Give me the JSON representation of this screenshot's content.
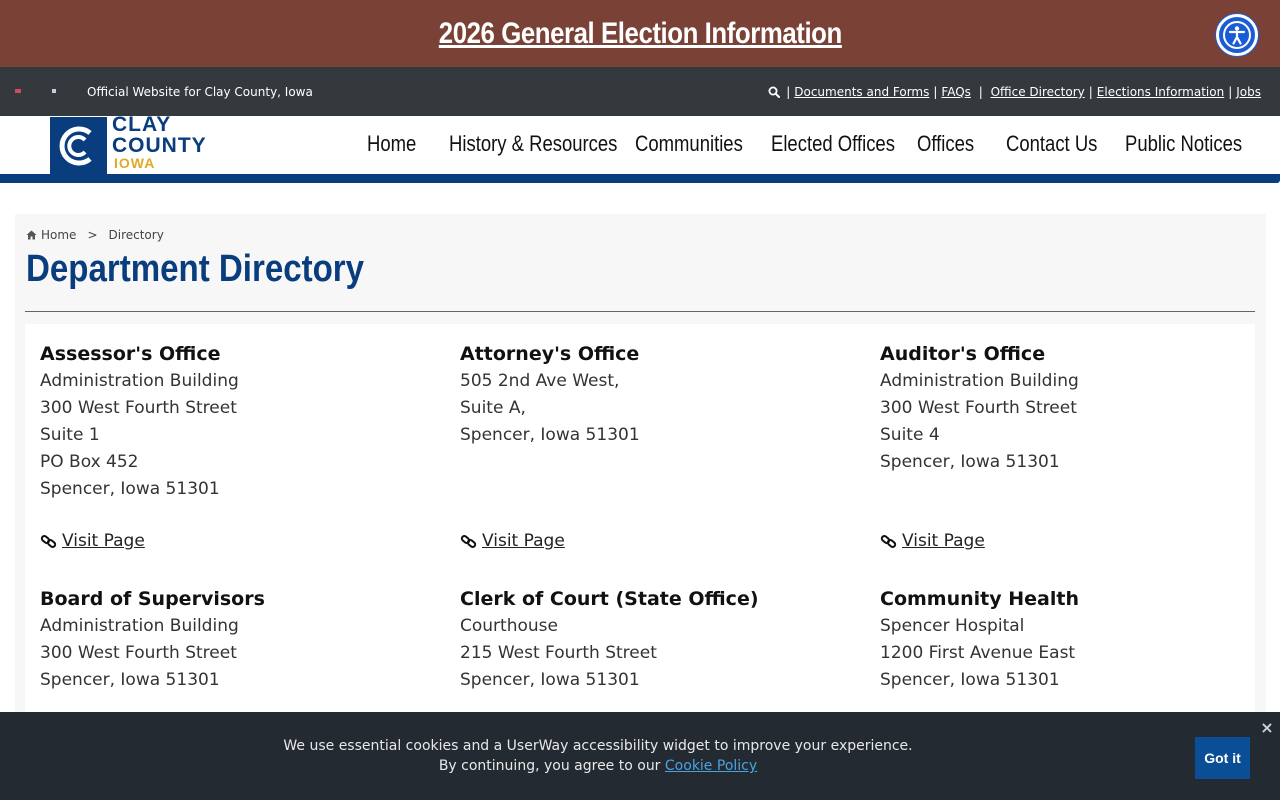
{
  "banner": {
    "election_link": "2026 General Election Information"
  },
  "accessibility": {
    "icon": "accessibility-icon"
  },
  "utility_bar": {
    "official_text": "Official Website for Clay County, Iowa",
    "links": [
      "Documents and Forms",
      "FAQs",
      "Office Directory",
      "Elections Information",
      "Jobs"
    ]
  },
  "logo": {
    "line1": "CLAY",
    "line2": "COUNTY",
    "line3": "IOWA"
  },
  "nav": {
    "items": [
      "Home",
      "History & Resources",
      "Communities",
      "Elected Offices",
      "Offices",
      "Contact Us",
      "Public Notices"
    ]
  },
  "breadcrumb": {
    "home": "Home",
    "separator": ">",
    "current": "Directory"
  },
  "page": {
    "title": "Department Directory"
  },
  "departments": [
    {
      "name": "Assessor's Office",
      "lines": [
        "Administration Building",
        "300 West Fourth Street",
        "Suite 1",
        "PO Box 452",
        "Spencer, Iowa 51301"
      ],
      "link_label": "Visit Page"
    },
    {
      "name": "Attorney's Office",
      "lines": [
        "505 2nd Ave West,",
        "Suite A,",
        "Spencer, Iowa 51301"
      ],
      "link_label": "Visit Page"
    },
    {
      "name": "Auditor's Office",
      "lines": [
        "Administration Building",
        "300 West Fourth Street",
        "Suite 4",
        "Spencer, Iowa 51301"
      ],
      "link_label": "Visit Page"
    },
    {
      "name": "Board of Supervisors",
      "lines": [
        "Administration Building",
        "300 West Fourth Street",
        "Spencer, Iowa 51301"
      ]
    },
    {
      "name": "Clerk of Court (State Office)",
      "lines": [
        "Courthouse",
        "215 West Fourth Street",
        "Spencer, Iowa 51301"
      ]
    },
    {
      "name": "Community Health",
      "lines": [
        "Spencer Hospital",
        "1200 First Avenue East",
        "Spencer, Iowa 51301"
      ]
    }
  ],
  "cookie": {
    "line1": "We use essential cookies and a UserWay accessibility widget to improve your experience.",
    "line2_prefix": "By continuing, you agree to our",
    "policy_link": "Cookie Policy",
    "button": "Got it",
    "close": "×"
  },
  "colors": {
    "banner": "#7a4136",
    "utility_bar": "#33393c",
    "brand_blue": "#0a3d7e",
    "brand_gold": "#e0a92a",
    "cookie_bar": "#242a32",
    "accessibility_blue": "#1a5cd6"
  }
}
